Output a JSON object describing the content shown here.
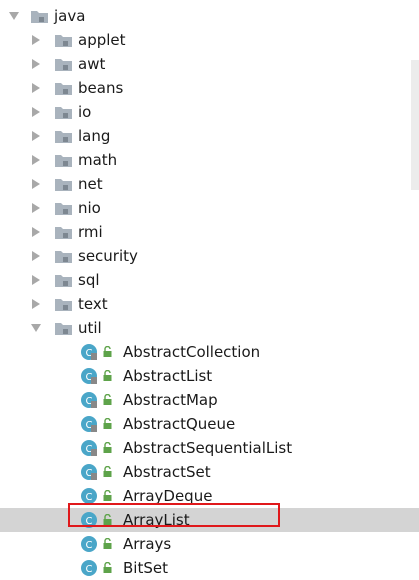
{
  "tree": {
    "root": {
      "label": "java",
      "expanded": true
    },
    "packages": [
      {
        "label": "applet",
        "expanded": false
      },
      {
        "label": "awt",
        "expanded": false
      },
      {
        "label": "beans",
        "expanded": false
      },
      {
        "label": "io",
        "expanded": false
      },
      {
        "label": "lang",
        "expanded": false
      },
      {
        "label": "math",
        "expanded": false
      },
      {
        "label": "net",
        "expanded": false
      },
      {
        "label": "nio",
        "expanded": false
      },
      {
        "label": "rmi",
        "expanded": false
      },
      {
        "label": "security",
        "expanded": false
      },
      {
        "label": "sql",
        "expanded": false
      },
      {
        "label": "text",
        "expanded": false
      },
      {
        "label": "util",
        "expanded": true
      }
    ],
    "util_classes": [
      {
        "label": "AbstractCollection",
        "kind": "abstract-class"
      },
      {
        "label": "AbstractList",
        "kind": "abstract-class"
      },
      {
        "label": "AbstractMap",
        "kind": "abstract-class"
      },
      {
        "label": "AbstractQueue",
        "kind": "abstract-class"
      },
      {
        "label": "AbstractSequentialList",
        "kind": "abstract-class"
      },
      {
        "label": "AbstractSet",
        "kind": "abstract-class"
      },
      {
        "label": "ArrayDeque",
        "kind": "class"
      },
      {
        "label": "ArrayList",
        "kind": "class",
        "selected": true
      },
      {
        "label": "Arrays",
        "kind": "class"
      },
      {
        "label": "BitSet",
        "kind": "class"
      }
    ]
  },
  "colors": {
    "selection": "#d4d4d4",
    "highlight_border": "#e0181b",
    "class_icon": "#4aa6c8",
    "lock_icon": "#5ea34a",
    "folder": "#a9b3bd"
  }
}
